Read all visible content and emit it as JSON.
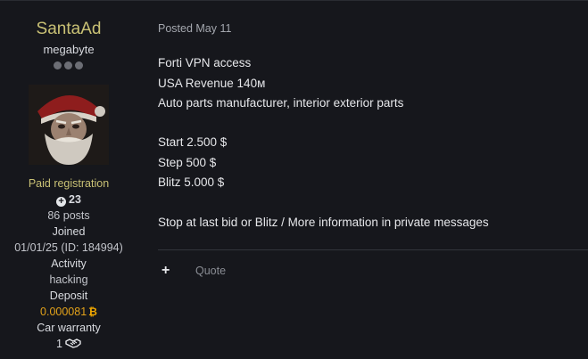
{
  "author": {
    "username": "SantaAd",
    "rank": "megabyte",
    "group": "Paid registration",
    "reputation": "23",
    "posts": "86 posts",
    "joined_label": "Joined",
    "joined_value": "01/01/25 (ID: 184994)",
    "activity_label": "Activity",
    "activity_value": "hacking",
    "deposit_label": "Deposit",
    "deposit_value": "0.000081",
    "warranty_label": "Car warranty",
    "warranty_value": "1"
  },
  "post": {
    "posted": "Posted May 11",
    "lines": [
      "Forti VPN access",
      "USA Revenue 140м",
      "Auto parts manufacturer, interior exterior parts",
      "",
      "Start 2.500 $",
      "Step  500 $",
      "Blitz 5.000 $",
      "",
      "Stop at last bid or Blitz / More information in private messages"
    ],
    "quote_label": "Quote"
  },
  "colors": {
    "background": "#16171c",
    "username": "#c9c175",
    "deposit": "#e3a21a"
  },
  "icons": [
    "plus-circle-icon",
    "bitcoin-icon",
    "handshake-icon",
    "plus-icon"
  ]
}
